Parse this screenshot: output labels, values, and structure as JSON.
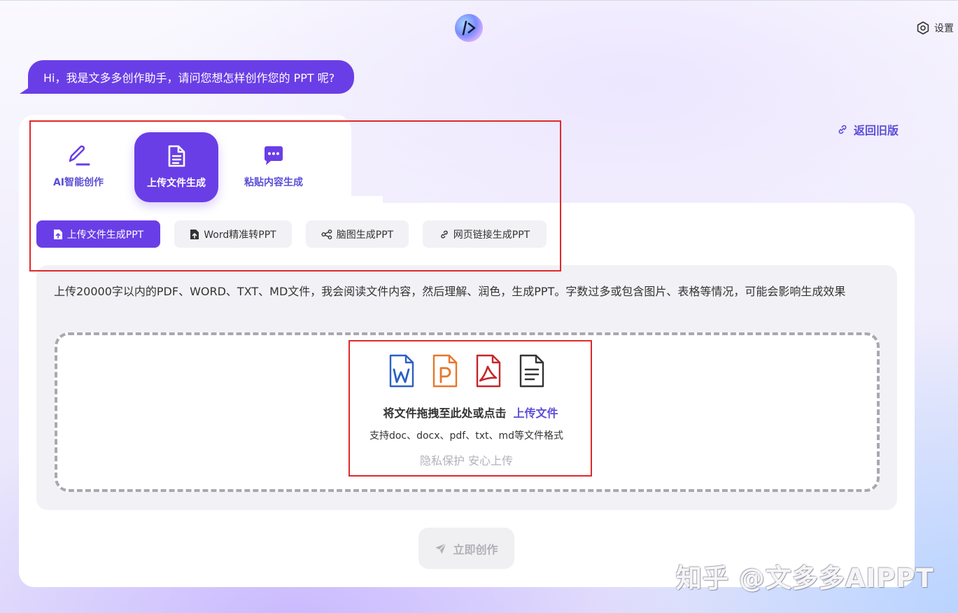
{
  "header": {
    "settings_label": "设置"
  },
  "greeting": "Hi，我是文多多创作助手，请问您想怎样创作您的 PPT 呢?",
  "return_link": "返回旧版",
  "mode_tabs": [
    {
      "label": "AI智能创作",
      "icon": "pen-icon",
      "active": false
    },
    {
      "label": "上传文件生成",
      "icon": "document-icon",
      "active": true
    },
    {
      "label": "粘贴内容生成",
      "icon": "chat-bubble-icon",
      "active": false
    }
  ],
  "sub_tabs": [
    {
      "label": "上传文件生成PPT",
      "icon": "file-upload-icon",
      "active": true
    },
    {
      "label": "Word精准转PPT",
      "icon": "file-upload-icon",
      "active": false
    },
    {
      "label": "脑图生成PPT",
      "icon": "share-nodes-icon",
      "active": false
    },
    {
      "label": "网页链接生成PPT",
      "icon": "link-icon",
      "active": false
    }
  ],
  "upload": {
    "description": "上传20000字以内的PDF、WORD、TXT、MD文件，我会阅读文件内容，然后理解、润色，生成PPT。字数过多或包含图片、表格等情况，可能会影响生成效果",
    "drop_text": "将文件拖拽至此处或点击",
    "upload_link": "上传文件",
    "formats": "支持doc、docx、pdf、txt、md等文件格式",
    "privacy": "隐私保护 安心上传",
    "file_icons": [
      "word-file-icon",
      "ppt-file-icon",
      "pdf-file-icon",
      "text-file-icon"
    ]
  },
  "create_button": "立即创作",
  "watermark": "知乎 @文多多AIPPT",
  "colors": {
    "accent": "#6a3ee6",
    "link": "#5b4ed6",
    "annotation": "#e0282a"
  }
}
